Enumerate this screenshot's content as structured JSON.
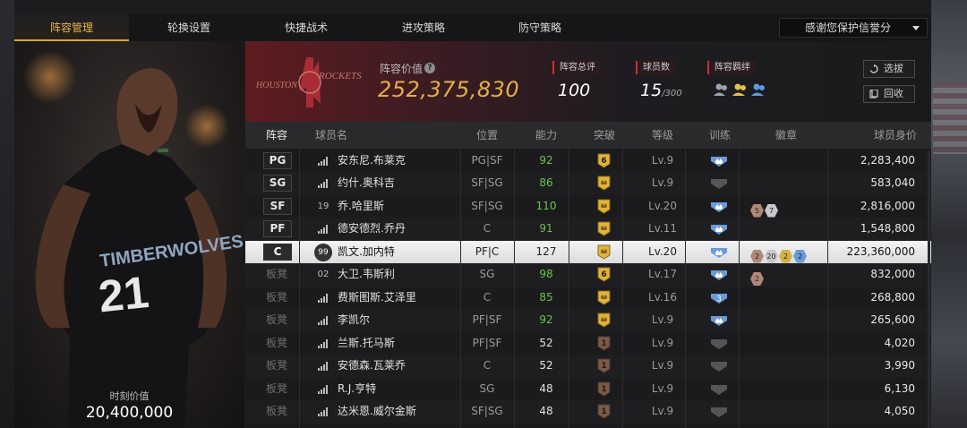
{
  "tabs": [
    {
      "label": "阵容管理",
      "active": true
    },
    {
      "label": "轮换设置",
      "active": false
    },
    {
      "label": "快捷战术",
      "active": false
    },
    {
      "label": "进攻策略",
      "active": false
    },
    {
      "label": "防守策略",
      "active": false
    }
  ],
  "filter": {
    "label": "感谢您保护信誉分"
  },
  "hero": {
    "value_label": "时刻价值",
    "value": "20,400,000"
  },
  "team": {
    "logo_text_left": "HOUSTON",
    "logo_text_right": "ROCKETS",
    "worth_label": "阵容价值",
    "worth": "252,375,830",
    "rating_label": "阵容总评",
    "rating": "100",
    "count_label": "球员数",
    "count": "15",
    "count_max": "/300",
    "bond_label": "阵容羁绊",
    "buttons": {
      "pick": "选拔",
      "recycle": "回收"
    }
  },
  "table": {
    "headers": [
      "阵容",
      "球员名",
      "位置",
      "能力",
      "突破",
      "等级",
      "训练",
      "徽章",
      "球员身价"
    ],
    "rows": [
      {
        "slot": "PG",
        "starter": true,
        "jersey": "",
        "name": "安东尼.布莱克",
        "pos": "PG|SF",
        "ability": "92",
        "ability_color": "#6cc24a",
        "breakthrough": "6",
        "brk_type": "gold",
        "level": "Lv.9",
        "train": "blue",
        "badges": [],
        "value": "2,283,400"
      },
      {
        "slot": "SG",
        "starter": true,
        "jersey": "",
        "name": "约什.奥科吉",
        "pos": "SF|SG",
        "ability": "86",
        "ability_color": "#6cc24a",
        "breakthrough": "",
        "brk_type": "gold",
        "level": "Lv.9",
        "train": "gray",
        "badges": [],
        "value": "583,040"
      },
      {
        "slot": "SF",
        "starter": true,
        "jersey": "19",
        "name": "乔.哈里斯",
        "pos": "SF|SG",
        "ability": "110",
        "ability_color": "#6cc24a",
        "breakthrough": "",
        "brk_type": "gold",
        "level": "Lv.20",
        "train": "blue",
        "badges": [
          {
            "n": "5",
            "c": "#b08878"
          },
          {
            "n": "7",
            "c": "#c8c8cc"
          }
        ],
        "value": "2,816,000"
      },
      {
        "slot": "PF",
        "starter": true,
        "jersey": "",
        "name": "德安德烈.乔丹",
        "pos": "C",
        "ability": "91",
        "ability_color": "#6cc24a",
        "breakthrough": "",
        "brk_type": "gold",
        "level": "Lv.11",
        "train": "blue",
        "badges": [],
        "value": "1,548,800"
      },
      {
        "slot": "C",
        "starter": true,
        "selected": true,
        "jersey": "99",
        "name": "凯文.加内特",
        "pos": "PF|C",
        "ability": "127",
        "ability_color": "#222222",
        "breakthrough": "",
        "brk_type": "gold",
        "level": "Lv.20",
        "train": "blue",
        "badges": [
          {
            "n": "2",
            "c": "#b08878"
          },
          {
            "n": "20",
            "c": "#c8c8cc"
          },
          {
            "n": "2",
            "c": "#d8b048"
          },
          {
            "n": "2",
            "c": "#6a9ad8"
          }
        ],
        "value": "223,360,000"
      },
      {
        "slot": "板凳",
        "starter": false,
        "jersey": "02",
        "name": "大卫.韦斯利",
        "pos": "SG",
        "ability": "98",
        "ability_color": "#6cc24a",
        "breakthrough": "6",
        "brk_type": "gold",
        "level": "Lv.17",
        "train": "blue",
        "badges": [
          {
            "n": "2",
            "c": "#b08878"
          }
        ],
        "value": "832,000"
      },
      {
        "slot": "板凳",
        "starter": false,
        "jersey": "",
        "name": "费斯图斯.艾泽里",
        "pos": "C",
        "ability": "85",
        "ability_color": "#6cc24a",
        "breakthrough": "",
        "brk_type": "gold",
        "level": "Lv.16",
        "train": "blue3",
        "badges": [],
        "value": "268,800"
      },
      {
        "slot": "板凳",
        "starter": false,
        "jersey": "",
        "name": "李凯尔",
        "pos": "PF|SF",
        "ability": "92",
        "ability_color": "#6cc24a",
        "breakthrough": "",
        "brk_type": "gold",
        "level": "Lv.9",
        "train": "blue",
        "badges": [],
        "value": "265,600"
      },
      {
        "slot": "板凳",
        "starter": false,
        "jersey": "",
        "name": "兰斯.托马斯",
        "pos": "PF|SF",
        "ability": "52",
        "ability_color": "#e2e2e2",
        "breakthrough": "1",
        "brk_type": "brown",
        "level": "Lv.9",
        "train": "gray",
        "badges": [],
        "value": "4,020"
      },
      {
        "slot": "板凳",
        "starter": false,
        "jersey": "",
        "name": "安德森.瓦莱乔",
        "pos": "C",
        "ability": "52",
        "ability_color": "#e2e2e2",
        "breakthrough": "1",
        "brk_type": "brown",
        "level": "Lv.9",
        "train": "gray",
        "badges": [],
        "value": "3,990"
      },
      {
        "slot": "板凳",
        "starter": false,
        "jersey": "",
        "name": "R.J.亨特",
        "pos": "SG",
        "ability": "48",
        "ability_color": "#e2e2e2",
        "breakthrough": "1",
        "brk_type": "brown",
        "level": "Lv.9",
        "train": "gray",
        "badges": [],
        "value": "6,130"
      },
      {
        "slot": "板凳",
        "starter": false,
        "jersey": "",
        "name": "达米恩.威尔金斯",
        "pos": "SF|SG",
        "ability": "48",
        "ability_color": "#e2e2e2",
        "breakthrough": "1",
        "brk_type": "brown",
        "level": "Lv.9",
        "train": "gray",
        "badges": [],
        "value": "4,050"
      }
    ]
  }
}
